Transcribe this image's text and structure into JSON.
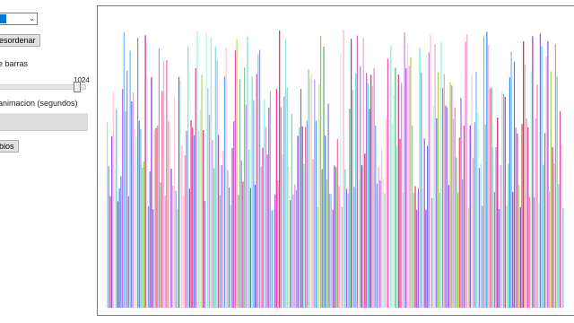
{
  "controls": {
    "algorithm_select": {
      "selected_value": "",
      "chevron_icon": "chevron-down-icon"
    },
    "shuffle_button_label": "esordenar",
    "bars_label": "e barras",
    "bars_value": "1024",
    "bars_slider_fraction": 0.93,
    "animation_label": "animacion (segundos)",
    "animation_progress_fraction": 0.0,
    "swaps_button_label": "bios"
  },
  "chart_data": {
    "type": "bar",
    "bar_count": 1024,
    "note_free": true,
    "xlabel": "",
    "ylabel": "",
    "title": "",
    "ylim": [
      0,
      1
    ],
    "grid": false,
    "palette": [
      "#ff69b4",
      "#ffb6c1",
      "#da70d6",
      "#9932cc",
      "#8a2be2",
      "#6a5acd",
      "#4169e1",
      "#1e90ff",
      "#40e0d0",
      "#48d1cc",
      "#7fffd4",
      "#3cb371",
      "#9acd32",
      "#dc143c",
      "#c71585",
      "#ff1493"
    ]
  }
}
